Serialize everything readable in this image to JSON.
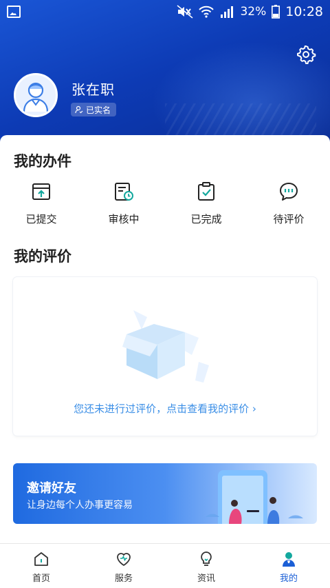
{
  "status_bar": {
    "battery": "32%",
    "time": "10:28"
  },
  "profile": {
    "name": "张在职",
    "verified_label": "已实名"
  },
  "my_cases": {
    "title": "我的办件",
    "items": [
      {
        "label": "已提交",
        "icon": "submitted-icon"
      },
      {
        "label": "审核中",
        "icon": "reviewing-icon"
      },
      {
        "label": "已完成",
        "icon": "completed-icon"
      },
      {
        "label": "待评价",
        "icon": "pending-review-icon"
      }
    ]
  },
  "my_reviews": {
    "title": "我的评价",
    "empty_link": "您还未进行过评价，点击查看我的评价 ›"
  },
  "invite": {
    "title": "邀请好友",
    "subtitle": "让身边每个人办事更容易"
  },
  "bottom_nav": {
    "items": [
      {
        "label": "首页",
        "icon": "home-icon"
      },
      {
        "label": "服务",
        "icon": "service-heart-icon"
      },
      {
        "label": "资讯",
        "icon": "news-bulb-icon"
      },
      {
        "label": "我的",
        "icon": "profile-icon"
      }
    ],
    "active_index": 3
  },
  "colors": {
    "header": "#1a56d6",
    "accent": "#1b5fd6",
    "link": "#3a8ee6",
    "icon_teal": "#13a89e"
  }
}
